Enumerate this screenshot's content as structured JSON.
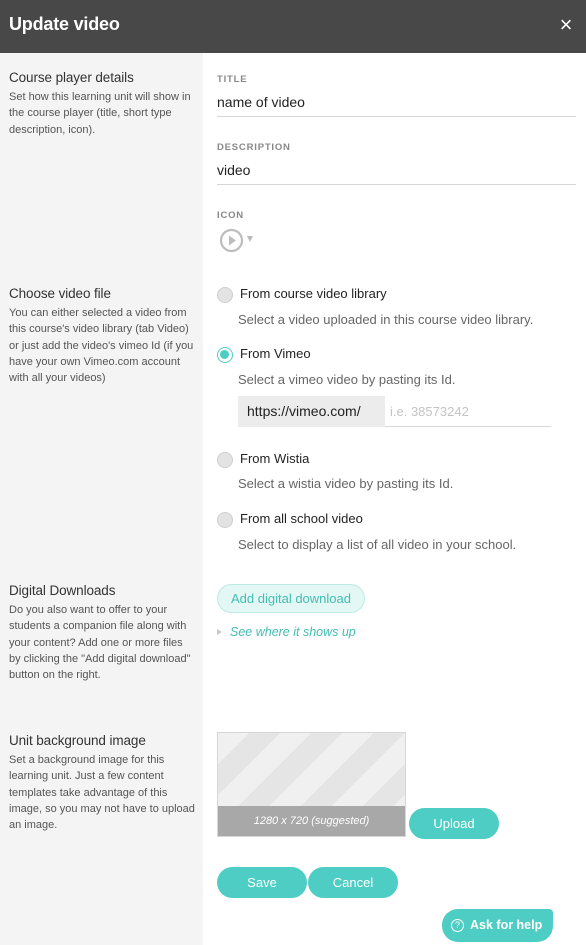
{
  "dialog": {
    "title": "Update video",
    "close_icon": "×"
  },
  "sections": {
    "course_player": {
      "heading": "Course player details",
      "description": "Set how this learning unit will show in the course player (title, short type description, icon)."
    },
    "choose_video": {
      "heading": "Choose video file",
      "description": "You can either selected a video from this course's video library (tab Video) or just add the video's vimeo Id (if you have your own Vimeo.com account with all your videos)"
    },
    "digital_downloads": {
      "heading": "Digital Downloads",
      "description": "Do you also want to offer to your students a companion file along with your content? Add one or more files by clicking the \"Add digital download\" button on the right."
    },
    "background_image": {
      "heading": "Unit background image",
      "description": "Set a background image for this learning unit. Just a few content templates take advantage of this image, so you may not have to upload an image."
    }
  },
  "form": {
    "title_label": "TITLE",
    "title_value": "name of video",
    "description_label": "DESCRIPTION",
    "description_value": "video",
    "icon_label": "ICON",
    "icon_selected": "play-circle-icon"
  },
  "video_source": {
    "selected": "vimeo",
    "options": [
      {
        "id": "library",
        "label": "From course video library",
        "description": "Select a video uploaded in this course video library."
      },
      {
        "id": "vimeo",
        "label": "From Vimeo",
        "description": "Select a vimeo video by pasting its Id."
      },
      {
        "id": "wistia",
        "label": "From Wistia",
        "description": "Select a wistia video by pasting its Id."
      },
      {
        "id": "school",
        "label": "From all school video",
        "description": "Select to display a list of all video in your school."
      }
    ],
    "vimeo_prefix": "https://vimeo.com/",
    "vimeo_value": "",
    "vimeo_placeholder": "i.e. 38573242"
  },
  "downloads": {
    "add_button": "Add digital download",
    "see_where_link": "See where it shows up"
  },
  "background": {
    "suggested_size": "1280 x 720 (suggested)",
    "upload_button": "Upload"
  },
  "actions": {
    "save": "Save",
    "cancel": "Cancel"
  },
  "help": {
    "label": "Ask for help",
    "icon": "?"
  },
  "colors": {
    "accent": "#4ecdc4",
    "header_bg": "#484848",
    "left_panel_bg": "#f4f4f4"
  }
}
